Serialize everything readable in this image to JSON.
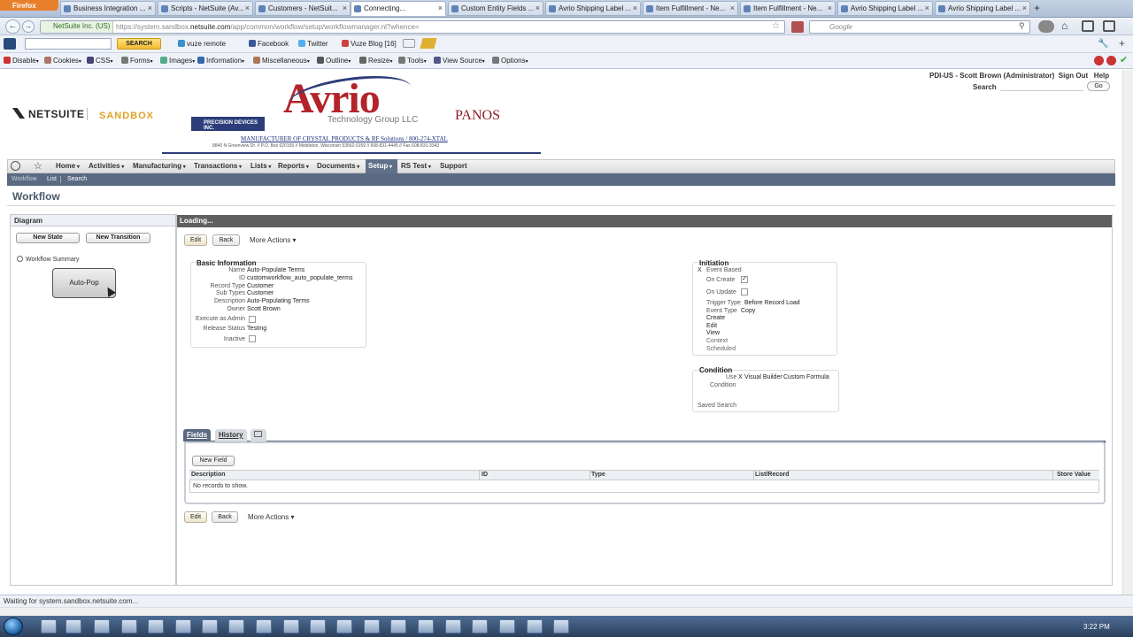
{
  "browser": {
    "app_button": "Firefox",
    "tabs": [
      {
        "label": "Business Integration ...",
        "active": false
      },
      {
        "label": "Scripts - NetSuite (Av...",
        "active": false
      },
      {
        "label": "Customers - NetSuit...",
        "active": false
      },
      {
        "label": "Connecting...",
        "active": true
      },
      {
        "label": "Custom Entity Fields ...",
        "active": false
      },
      {
        "label": "Avrio Shipping Label ...",
        "active": false
      },
      {
        "label": "Item Fulfillment - Ne...",
        "active": false
      },
      {
        "label": "Item Fulfillment - Ne...",
        "active": false
      },
      {
        "label": "Avrio Shipping Label ...",
        "active": false
      },
      {
        "label": "Avrio Shipping Label ...",
        "active": false
      }
    ],
    "identity": "NetSuite Inc. (US)",
    "url_prefix": "https://system.sandbox.",
    "url_domain": "netsuite.com",
    "url_suffix": "/app/common/workflow/setup/workflowmanager.nl?whence=",
    "search_placeholder": "Google",
    "toolbar1": {
      "search_button": "SEARCH",
      "items": [
        "vuze remote",
        "Facebook",
        "Twitter",
        "Vuze Blog [16]"
      ]
    },
    "toolbar2": {
      "items": [
        "Disable",
        "Cookies",
        "CSS",
        "Forms",
        "Images",
        "Information",
        "Miscellaneous",
        "Outline",
        "Resize",
        "Tools",
        "View Source",
        "Options"
      ]
    },
    "status": "Waiting for system.sandbox.netsuite.com..."
  },
  "header": {
    "netsuite": "NETSUITE",
    "sandbox": "SANDBOX",
    "avrio": "Avrio",
    "avrio_sub": "Technology Group LLC",
    "precision": "PRECISION DEVICES INC.",
    "panos": "PANOS",
    "manufacturer": "MANUFACTURER OF CRYSTAL PRODUCTS & RF Solutions / 800-274-XTAL",
    "address": "8840 N Greenview Dr. // P.O. Box 620159 // Middleton, Wisconsin 53562-0159 // 608-831-4445 // Fax 608-831-3343",
    "user": "PDI-US - Scott Brown (Administrator)",
    "sign_out": "Sign Out",
    "help": "Help",
    "search_label": "Search",
    "go": "Go"
  },
  "menu": {
    "items": [
      "Home",
      "Activities",
      "Manufacturing",
      "Transactions",
      "Lists",
      "Reports",
      "Documents",
      "Setup",
      "RS Test",
      "Support"
    ],
    "sub": [
      "Workflow",
      "List",
      "Search"
    ]
  },
  "page": {
    "title": "Workflow",
    "loading": "Loading..."
  },
  "diagram": {
    "header": "Diagram",
    "new_state": "New State",
    "new_transition": "New Transition",
    "summary": "Workflow Summary",
    "state": "Auto-Pop"
  },
  "actions": {
    "edit": "Edit",
    "back": "Back",
    "more": "More Actions"
  },
  "basic": {
    "title": "Basic Information",
    "name_label": "Name",
    "name": "Auto-Populate Terms",
    "id_label": "ID",
    "id": "customworkflow_auto_populate_terms",
    "record_type_label": "Record Type",
    "record_type": "Customer",
    "sub_types_label": "Sub Types",
    "sub_types": "Customer",
    "description_label": "Description",
    "description": "Auto-Populating Terms",
    "owner_label": "Owner",
    "owner": "Scott Brown",
    "execute_label": "Execute as Admin",
    "release_label": "Release Status",
    "release": "Testing",
    "inactive_label": "Inactive"
  },
  "initiation": {
    "title": "Initiation",
    "mark": "X",
    "event_based": "Event Based",
    "on_create": "On Create",
    "on_update": "On Update",
    "trigger_label": "Trigger Type",
    "trigger": "Before Record Load",
    "event_label": "Event Type",
    "event": "Copy",
    "event_options": [
      "Create",
      "Edit",
      "View",
      "Context",
      "Scheduled"
    ]
  },
  "condition": {
    "title": "Condition",
    "use_label": "Use",
    "mark": "X",
    "visual_builder": "Visual Builder",
    "custom_formula": "Custom Formula",
    "condition_label": "Condition",
    "saved_search": "Saved Search"
  },
  "subtabs": {
    "fields": "Fields",
    "history": "History",
    "new_field": "New Field",
    "columns": [
      "Description",
      "ID",
      "Type",
      "List/Record",
      "Store Value"
    ],
    "empty": "No records to show."
  },
  "taskbar": {
    "time": "3:22 PM"
  }
}
